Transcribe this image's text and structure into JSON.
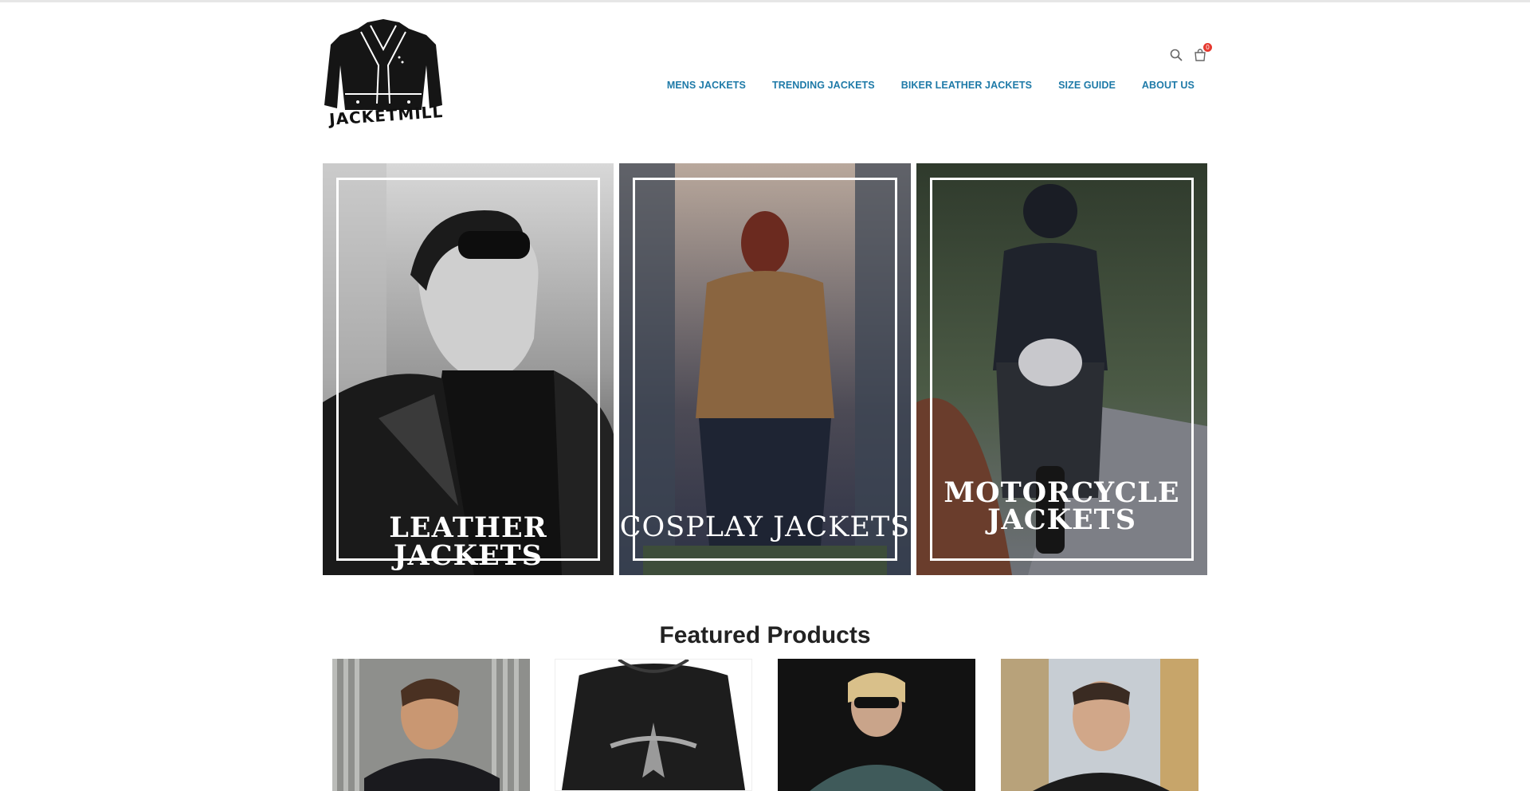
{
  "brand": {
    "logo_text": "JACKETMILL"
  },
  "header": {
    "cart_count": "0",
    "nav": [
      {
        "label": "MENS JACKETS"
      },
      {
        "label": "TRENDING JACKETS"
      },
      {
        "label": "BIKER LEATHER JACKETS"
      },
      {
        "label": "SIZE GUIDE"
      },
      {
        "label": "ABOUT US"
      }
    ]
  },
  "banners": [
    {
      "caption": "LEATHER JACKETS"
    },
    {
      "caption": "COSPLAY JACKETS"
    },
    {
      "caption_line1": "MOTORCYCLE",
      "caption_line2": "JACKETS"
    }
  ],
  "featured": {
    "title": "Featured Products"
  },
  "icons": {
    "search": "search-icon",
    "cart": "cart-icon"
  },
  "colors": {
    "nav_link": "#1e7aa8",
    "cart_badge": "#e6392f",
    "heading": "#222222"
  }
}
